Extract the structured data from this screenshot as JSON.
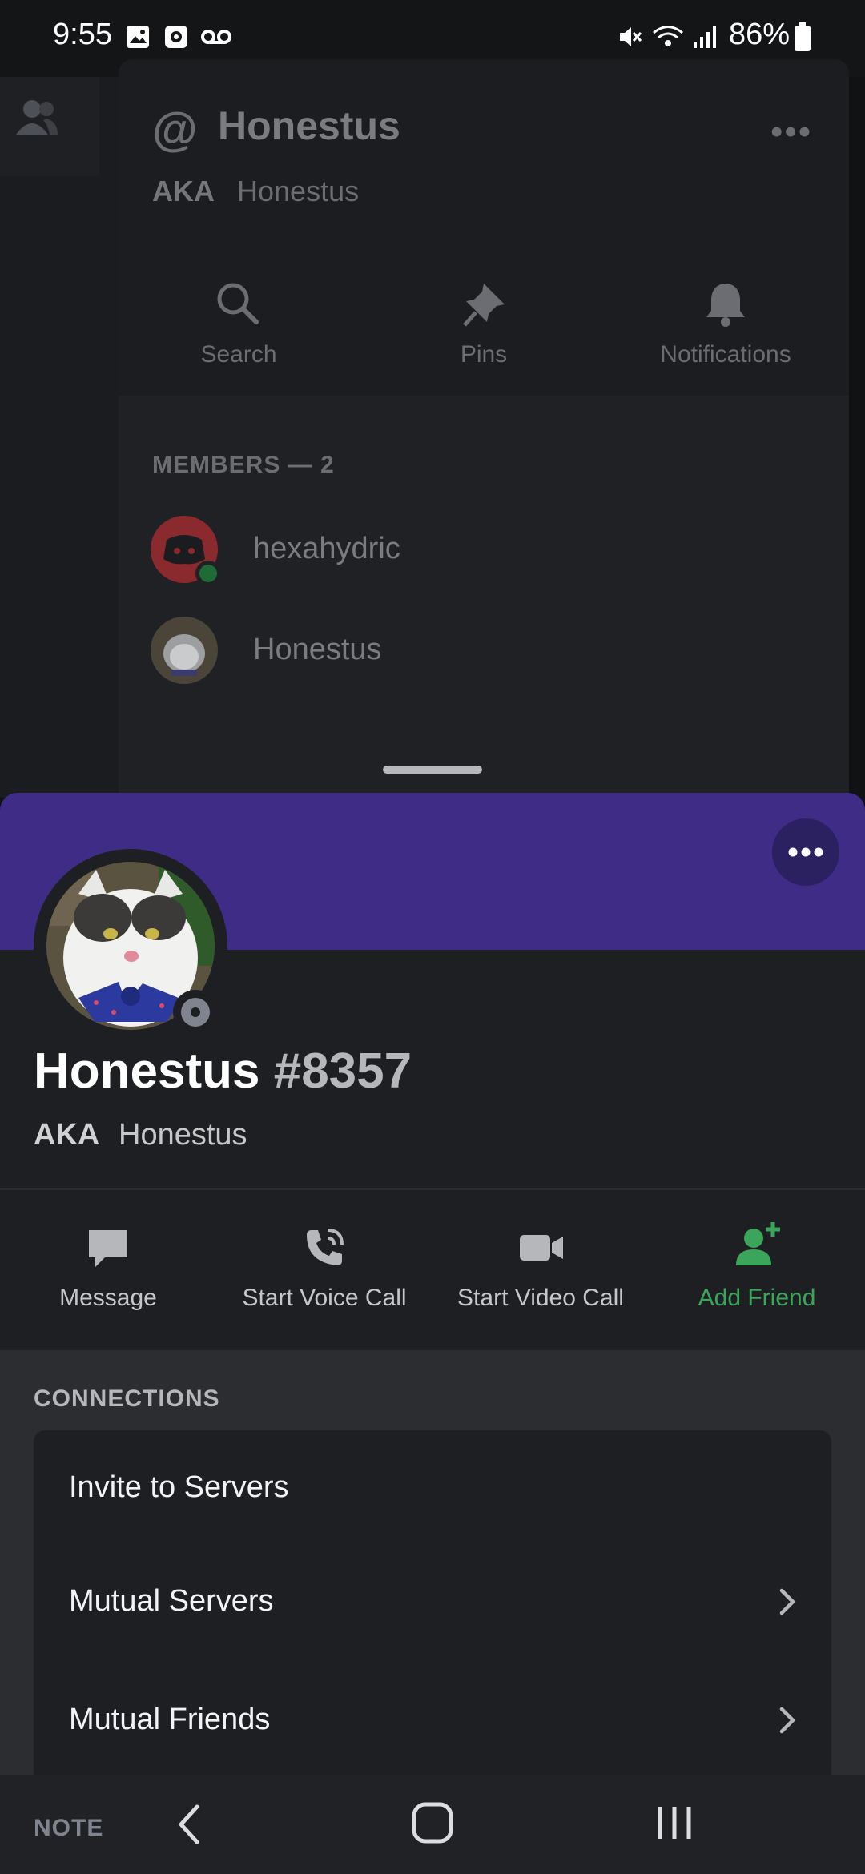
{
  "status_bar": {
    "time": "9:55",
    "battery": "86%",
    "icons": [
      "gallery-icon",
      "screen-record-icon",
      "voicemail-icon",
      "mute-icon",
      "wifi-icon",
      "signal-icon",
      "battery-icon"
    ]
  },
  "background_drawer": {
    "at_symbol": "@",
    "title": "Honestus",
    "aka_label": "AKA",
    "aka_name": "Honestus",
    "tools": [
      {
        "label": "Search",
        "icon": "search-icon"
      },
      {
        "label": "Pins",
        "icon": "pin-icon"
      },
      {
        "label": "Notifications",
        "icon": "bell-icon"
      }
    ],
    "members_label": "MEMBERS — 2",
    "members": [
      {
        "name": "hexahydric",
        "status": "online"
      },
      {
        "name": "Honestus",
        "status": "offline"
      }
    ]
  },
  "profile": {
    "username": "Honestus",
    "discriminator": "#8357",
    "aka_label": "AKA",
    "aka_name": "Honestus",
    "banner_color": "#3f2c86",
    "status": "offline"
  },
  "actions": [
    {
      "label": "Message",
      "icon": "message-icon"
    },
    {
      "label": "Start Voice Call",
      "icon": "voice-call-icon"
    },
    {
      "label": "Start Video Call",
      "icon": "video-call-icon"
    },
    {
      "label": "Add Friend",
      "icon": "add-friend-icon",
      "color": "#3ba55c"
    }
  ],
  "connections": {
    "label": "CONNECTIONS",
    "rows": [
      {
        "label": "Invite to Servers",
        "has_chevron": false
      },
      {
        "label": "Mutual Servers",
        "has_chevron": true
      },
      {
        "label": "Mutual Friends",
        "has_chevron": true
      }
    ]
  },
  "note_label": "NOTE",
  "navbar": [
    "back-icon",
    "home-icon",
    "recents-icon"
  ]
}
